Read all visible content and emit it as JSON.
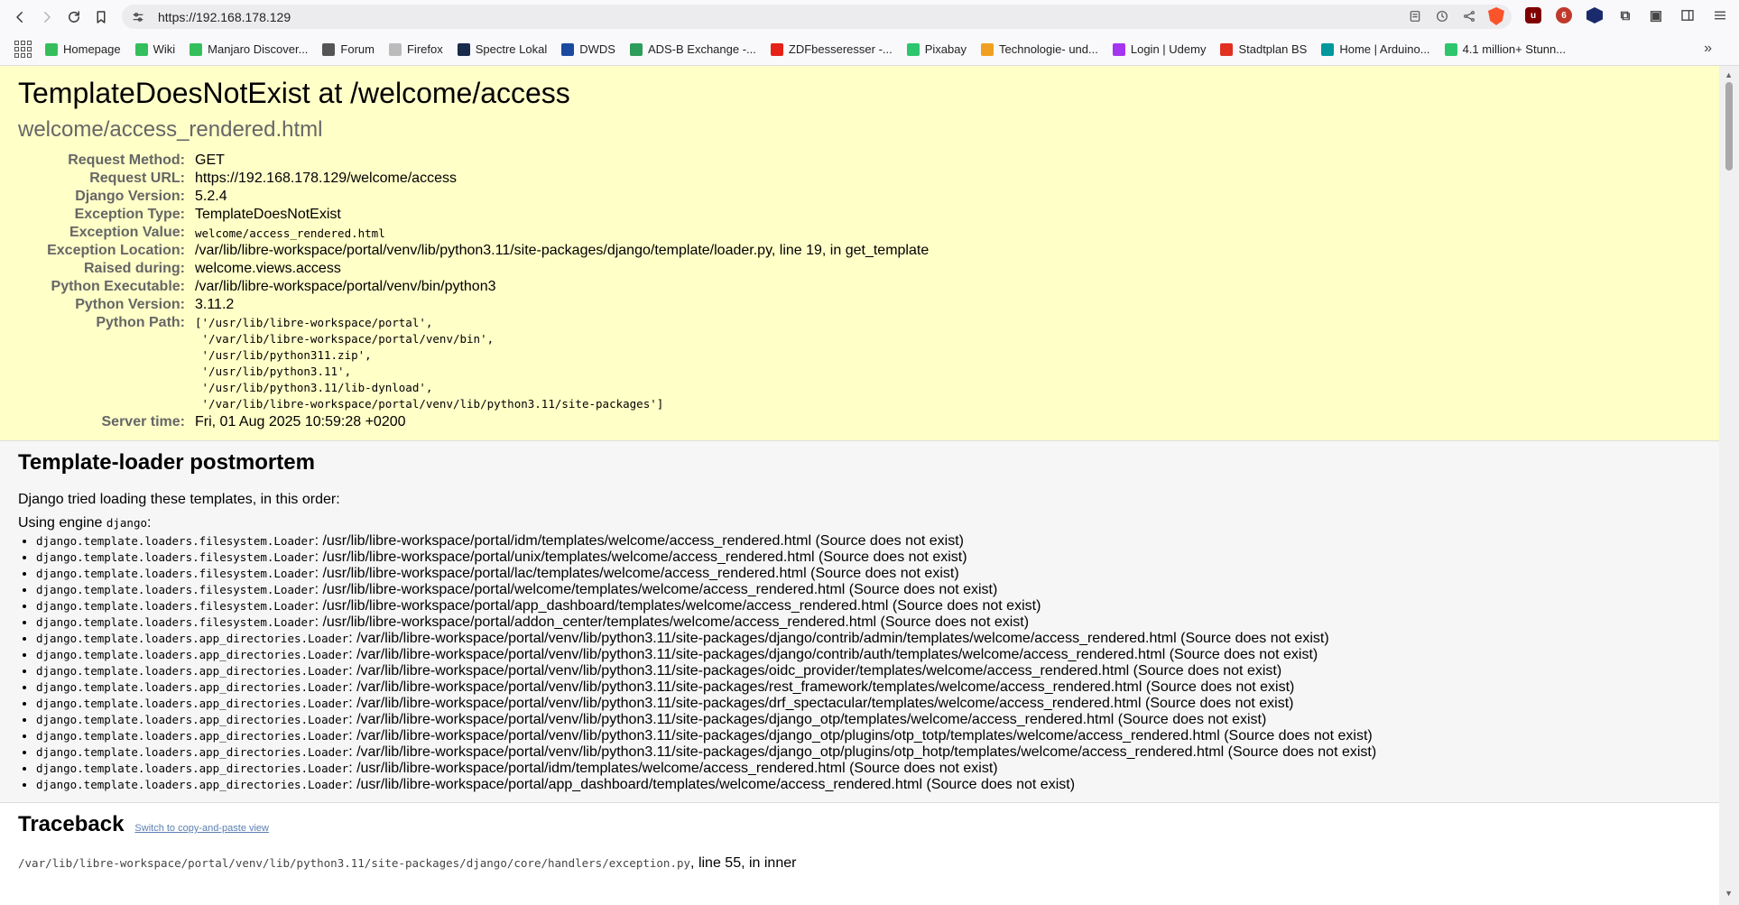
{
  "browser": {
    "url": "https://192.168.178.129",
    "bookmarks": [
      {
        "label": "Homepage",
        "color": "#35bf5c"
      },
      {
        "label": "Wiki",
        "color": "#35bf5c"
      },
      {
        "label": "Manjaro Discover...",
        "color": "#35bf5c"
      },
      {
        "label": "Forum",
        "color": "#555555"
      },
      {
        "label": "Firefox",
        "color": "#bbbbbb"
      },
      {
        "label": "Spectre Lokal",
        "color": "#1a2a4a"
      },
      {
        "label": "DWDS",
        "color": "#1a4aa0"
      },
      {
        "label": "ADS-B Exchange -...",
        "color": "#2e9c5a"
      },
      {
        "label": "ZDFbesseresser -...",
        "color": "#e62117"
      },
      {
        "label": "Pixabay",
        "color": "#2ec66d"
      },
      {
        "label": "Technologie- und...",
        "color": "#f0a020"
      },
      {
        "label": "Login | Udemy",
        "color": "#a435f0"
      },
      {
        "label": "Stadtplan BS",
        "color": "#e03020"
      },
      {
        "label": "Home | Arduino...",
        "color": "#00979d"
      },
      {
        "label": "4.1 million+ Stunn...",
        "color": "#2ec66d"
      }
    ]
  },
  "summary": {
    "title": "TemplateDoesNotExist at /welcome/access",
    "subtitle": "welcome/access_rendered.html",
    "rows": [
      {
        "label": "Request Method:",
        "value": "GET"
      },
      {
        "label": "Request URL:",
        "value": "https://192.168.178.129/welcome/access"
      },
      {
        "label": "Django Version:",
        "value": "5.2.4"
      },
      {
        "label": "Exception Type:",
        "value": "TemplateDoesNotExist"
      }
    ],
    "exception_value_label": "Exception Value:",
    "exception_value": "welcome/access_rendered.html",
    "rows2": [
      {
        "label": "Exception Location:",
        "value": "/var/lib/libre-workspace/portal/venv/lib/python3.11/site-packages/django/template/loader.py, line 19, in get_template"
      },
      {
        "label": "Raised during:",
        "value": "welcome.views.access"
      },
      {
        "label": "Python Executable:",
        "value": "/var/lib/libre-workspace/portal/venv/bin/python3"
      },
      {
        "label": "Python Version:",
        "value": "3.11.2"
      }
    ],
    "python_path_label": "Python Path:",
    "python_path": "['/usr/lib/libre-workspace/portal',\n '/var/lib/libre-workspace/portal/venv/bin',\n '/usr/lib/python311.zip',\n '/usr/lib/python3.11',\n '/usr/lib/python3.11/lib-dynload',\n '/var/lib/libre-workspace/portal/venv/lib/python3.11/site-packages']",
    "server_time_label": "Server time:",
    "server_time": "Fri, 01 Aug 2025 10:59:28 +0200"
  },
  "postmortem": {
    "heading": "Template-loader postmortem",
    "intro": "Django tried loading these templates, in this order:",
    "engine_prefix": "Using engine ",
    "engine": "django",
    "engine_suffix": ":",
    "items": [
      {
        "loader": "django.template.loaders.filesystem.Loader",
        "path": ": /usr/lib/libre-workspace/portal/idm/templates/welcome/access_rendered.html (Source does not exist)"
      },
      {
        "loader": "django.template.loaders.filesystem.Loader",
        "path": ": /usr/lib/libre-workspace/portal/unix/templates/welcome/access_rendered.html (Source does not exist)"
      },
      {
        "loader": "django.template.loaders.filesystem.Loader",
        "path": ": /usr/lib/libre-workspace/portal/lac/templates/welcome/access_rendered.html (Source does not exist)"
      },
      {
        "loader": "django.template.loaders.filesystem.Loader",
        "path": ": /usr/lib/libre-workspace/portal/welcome/templates/welcome/access_rendered.html (Source does not exist)"
      },
      {
        "loader": "django.template.loaders.filesystem.Loader",
        "path": ": /usr/lib/libre-workspace/portal/app_dashboard/templates/welcome/access_rendered.html (Source does not exist)"
      },
      {
        "loader": "django.template.loaders.filesystem.Loader",
        "path": ": /usr/lib/libre-workspace/portal/addon_center/templates/welcome/access_rendered.html (Source does not exist)"
      },
      {
        "loader": "django.template.loaders.app_directories.Loader",
        "path": ": /var/lib/libre-workspace/portal/venv/lib/python3.11/site-packages/django/contrib/admin/templates/welcome/access_rendered.html (Source does not exist)"
      },
      {
        "loader": "django.template.loaders.app_directories.Loader",
        "path": ": /var/lib/libre-workspace/portal/venv/lib/python3.11/site-packages/django/contrib/auth/templates/welcome/access_rendered.html (Source does not exist)"
      },
      {
        "loader": "django.template.loaders.app_directories.Loader",
        "path": ": /var/lib/libre-workspace/portal/venv/lib/python3.11/site-packages/oidc_provider/templates/welcome/access_rendered.html (Source does not exist)"
      },
      {
        "loader": "django.template.loaders.app_directories.Loader",
        "path": ": /var/lib/libre-workspace/portal/venv/lib/python3.11/site-packages/rest_framework/templates/welcome/access_rendered.html (Source does not exist)"
      },
      {
        "loader": "django.template.loaders.app_directories.Loader",
        "path": ": /var/lib/libre-workspace/portal/venv/lib/python3.11/site-packages/drf_spectacular/templates/welcome/access_rendered.html (Source does not exist)"
      },
      {
        "loader": "django.template.loaders.app_directories.Loader",
        "path": ": /var/lib/libre-workspace/portal/venv/lib/python3.11/site-packages/django_otp/templates/welcome/access_rendered.html (Source does not exist)"
      },
      {
        "loader": "django.template.loaders.app_directories.Loader",
        "path": ": /var/lib/libre-workspace/portal/venv/lib/python3.11/site-packages/django_otp/plugins/otp_totp/templates/welcome/access_rendered.html (Source does not exist)"
      },
      {
        "loader": "django.template.loaders.app_directories.Loader",
        "path": ": /var/lib/libre-workspace/portal/venv/lib/python3.11/site-packages/django_otp/plugins/otp_hotp/templates/welcome/access_rendered.html (Source does not exist)"
      },
      {
        "loader": "django.template.loaders.app_directories.Loader",
        "path": ": /usr/lib/libre-workspace/portal/idm/templates/welcome/access_rendered.html (Source does not exist)"
      },
      {
        "loader": "django.template.loaders.app_directories.Loader",
        "path": ": /usr/lib/libre-workspace/portal/app_dashboard/templates/welcome/access_rendered.html (Source does not exist)"
      }
    ]
  },
  "traceback": {
    "heading": "Traceback",
    "switch_link": "Switch to copy-and-paste view",
    "first_file": "/var/lib/libre-workspace/portal/venv/lib/python3.11/site-packages/django/core/handlers/exception.py",
    "first_suffix": ", line 55, in inner"
  }
}
